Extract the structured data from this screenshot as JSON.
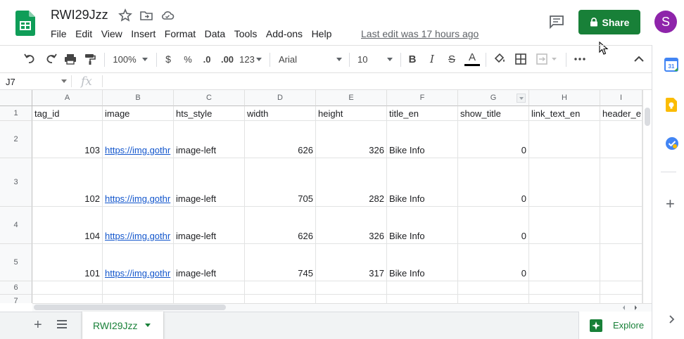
{
  "doc": {
    "title": "RWI29Jzz",
    "last_edit": "Last edit was 17 hours ago"
  },
  "menu": [
    "File",
    "Edit",
    "View",
    "Insert",
    "Format",
    "Data",
    "Tools",
    "Add-ons",
    "Help"
  ],
  "share": {
    "label": "Share"
  },
  "user": {
    "initial": "S",
    "color": "#8e24aa"
  },
  "toolbar": {
    "zoom": "100%",
    "currency": "$",
    "percent": "%",
    "dec_less": ".0",
    "dec_more": ".00",
    "format_more": "123",
    "font": "Arial",
    "font_size": "10",
    "bold": "B",
    "italic": "I",
    "strike": "S",
    "text_color": "A"
  },
  "formula_bar": {
    "cell_ref": "J7",
    "fx": "fx"
  },
  "columns": [
    "A",
    "B",
    "C",
    "D",
    "E",
    "F",
    "G",
    "H",
    "I"
  ],
  "rows": [
    {
      "num": "1",
      "cells": [
        "tag_id",
        "image",
        "hts_style",
        "width",
        "height",
        "title_en",
        "show_title",
        "link_text_en",
        "header_e"
      ]
    },
    {
      "num": "2",
      "cells": [
        "103",
        "https://img.gothr",
        "image-left",
        "626",
        "326",
        "Bike Info",
        "0",
        "",
        ""
      ]
    },
    {
      "num": "3",
      "cells": [
        "102",
        "https://img.gothr",
        "image-left",
        "705",
        "282",
        "Bike Info",
        "0",
        "",
        ""
      ]
    },
    {
      "num": "4",
      "cells": [
        "104",
        "https://img.gothr",
        "image-left",
        "626",
        "326",
        "Bike Info",
        "0",
        "",
        ""
      ]
    },
    {
      "num": "5",
      "cells": [
        "101",
        "https://img.gothr",
        "image-left",
        "745",
        "317",
        "Bike Info",
        "0",
        "",
        ""
      ]
    },
    {
      "num": "6",
      "cells": [
        "",
        "",
        "",
        "",
        "",
        "",
        "",
        "",
        ""
      ]
    },
    {
      "num": "7",
      "cells": [
        "",
        "",
        "",
        "",
        "",
        "",
        "",
        "",
        ""
      ]
    }
  ],
  "sheet": {
    "name": "RWI29Jzz"
  },
  "explore": {
    "label": "Explore"
  },
  "colors": {
    "accent": "#188038",
    "link": "#1155cc"
  }
}
